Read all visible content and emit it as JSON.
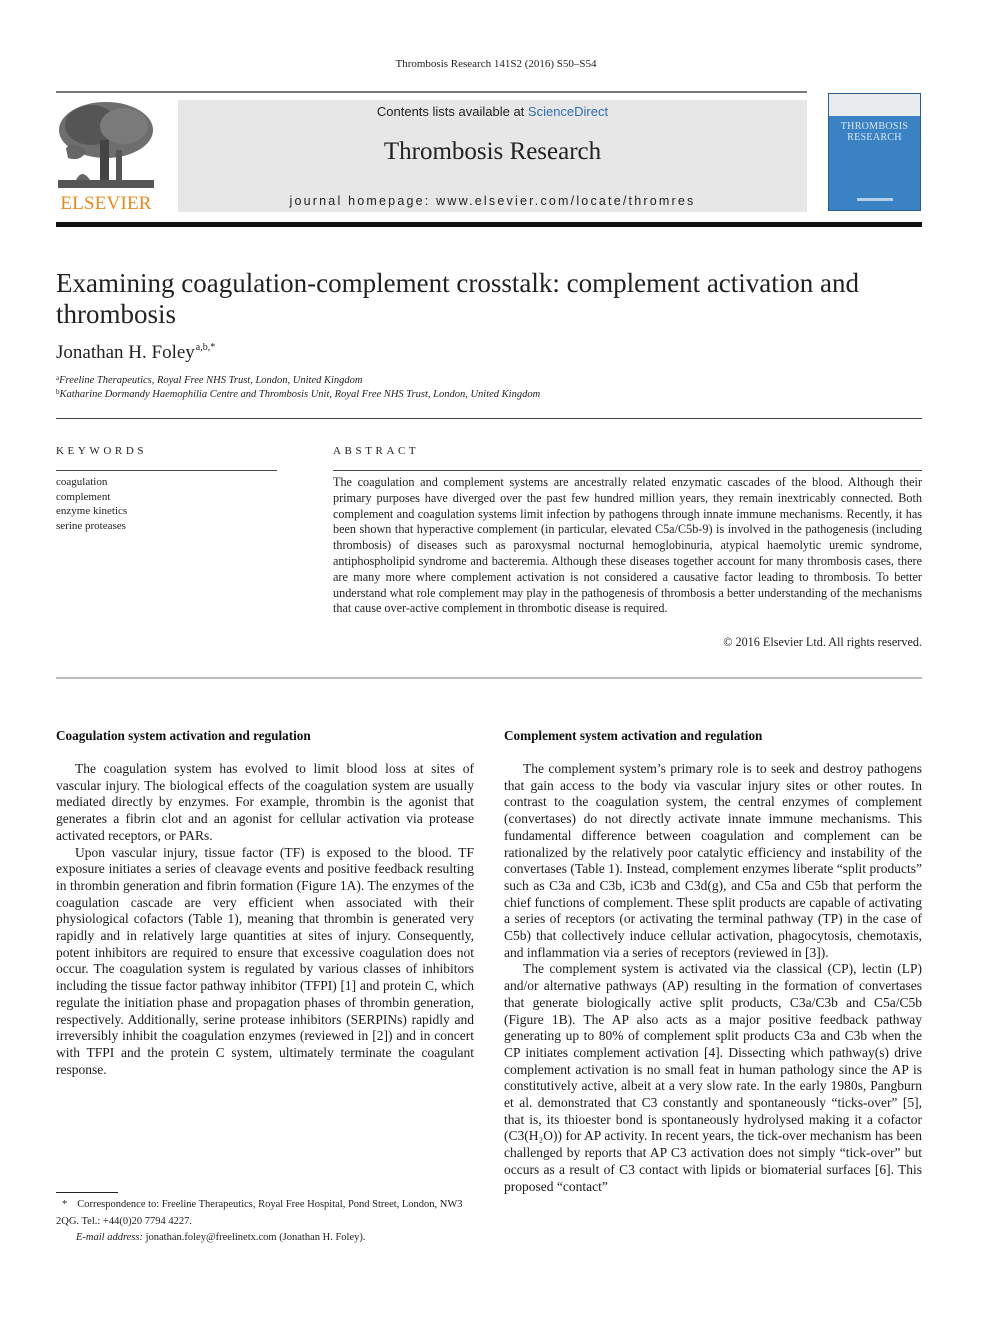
{
  "header": {
    "citation": "Thrombosis Research 141S2 (2016) S50–S54",
    "contents_prefix": "Contents lists available at ",
    "contents_link": "ScienceDirect",
    "journal_title": "Thrombosis Research",
    "homepage": "journal homepage: www.elsevier.com/locate/thromres",
    "publisher": "ELSEVIER",
    "cover_title": "THROMBOSIS RESEARCH",
    "colors": {
      "publisher_orange": "#e88a1a",
      "link_blue": "#2f6fb0",
      "cover_blue": "#3b82c4",
      "masthead_gray": "#e7e7e7"
    }
  },
  "article": {
    "title": "Examining coagulation-complement crosstalk: complement activation and thrombosis",
    "author": "Jonathan H. Foley",
    "author_marks": "a,b,*",
    "affiliations": [
      {
        "mark": "a",
        "text": "Freeline Therapeutics, Royal Free NHS Trust, London, United Kingdom"
      },
      {
        "mark": "b",
        "text": "Katharine Dormandy Haemophilia Centre and Thrombosis Unit, Royal Free NHS Trust, London, United Kingdom"
      }
    ]
  },
  "keywords": {
    "label": "KEYWORDS",
    "items": [
      "coagulation",
      "complement",
      "enzyme kinetics",
      "serine proteases"
    ]
  },
  "abstract": {
    "label": "ABSTRACT",
    "text": "The coagulation and complement systems are ancestrally related enzymatic cascades of the blood. Although their primary purposes have diverged over the past few hundred million years, they remain inextricably connected. Both complement and coagulation systems limit infection by pathogens through innate immune mechanisms. Recently, it has been shown that hyperactive complement (in particular, elevated C5a/C5b-9) is involved in the pathogenesis (including thrombosis) of diseases such as paroxysmal nocturnal hemoglobinuria, atypical haemolytic uremic syndrome, antiphospholipid syndrome and bacteremia. Although these diseases together account for many thrombosis cases, there are many more where complement activation is not considered a causative factor leading to thrombosis. To better understand what role complement may play in the pathogenesis of thrombosis a better understanding of the mechanisms that cause over-active complement in thrombotic disease is required.",
    "copyright": "© 2016 Elsevier Ltd. All rights reserved."
  },
  "sections": {
    "left": {
      "heading": "Coagulation system activation and regulation",
      "paragraphs": [
        "The coagulation system has evolved to limit blood loss at sites of vascular injury. The biological effects of the coagulation system are usually mediated directly by enzymes. For example, thrombin is the agonist that generates a fibrin clot and an agonist for cellular activation via protease activated receptors, or PARs.",
        "Upon vascular injury, tissue factor (TF) is exposed to the blood. TF exposure initiates a series of cleavage events and positive feedback resulting in thrombin generation and fibrin formation (Figure 1A). The enzymes of the coagulation cascade are very efficient when associated with their physiological cofactors (Table 1), meaning that thrombin is generated very rapidly and in relatively large quantities at sites of injury. Consequently, potent inhibitors are required to ensure that excessive coagulation does not occur. The coagulation system is regulated by various classes of inhibitors including the tissue factor pathway inhibitor (TFPI) [1] and protein C, which regulate the initiation phase and propagation phases of thrombin generation, respectively. Additionally, serine protease inhibitors (SERPINs) rapidly and irreversibly inhibit the coagulation enzymes (reviewed in [2]) and in concert with TFPI and the protein C system, ultimately terminate the coagulant response."
      ]
    },
    "right": {
      "heading": "Complement system activation and regulation",
      "paragraphs": [
        "The complement system’s primary role is to seek and destroy pathogens that gain access to the body via vascular injury sites or other routes. In contrast to the coagulation system, the central enzymes of complement (convertases) do not directly activate innate immune mechanisms. This fundamental difference between coagulation and complement can be rationalized by the relatively poor catalytic efficiency and instability of the convertases (Table 1). Instead, complement enzymes liberate “split products” such as C3a and C3b, iC3b and C3d(g), and C5a and C5b that perform the chief functions of complement. These split products are capable of activating a series of receptors (or activating the terminal pathway (TP) in the case of C5b) that collectively induce cellular activation, phagocytosis, chemotaxis, and inflammation via a series of receptors (reviewed in [3]).",
        "The complement system is activated via the classical (CP), lectin (LP) and/or alternative pathways (AP) resulting in the formation of convertases that generate biologically active split products, C3a/C3b and C5a/C5b (Figure 1B). The AP also acts as a major positive feedback pathway generating up to 80% of complement split products C3a and C3b when the CP initiates complement activation [4]. Dissecting which pathway(s) drive complement activation is no small feat in human pathology since the AP is constitutively active, albeit at a very slow rate. In the early 1980s, Pangburn et al. demonstrated that C3 constantly and spontaneously “ticks-over” [5], that is, its thioester bond is spontaneously hydrolysed making it a cofactor (C3(H₂O)) for AP activity. In recent years, the tick-over mechanism has been challenged by reports that AP C3 activation does not simply “tick-over” but occurs as a result of C3 contact with lipids or biomaterial surfaces [6]. This proposed “contact”"
      ]
    }
  },
  "footnote": {
    "star": "*",
    "correspondence": "Correspondence to: Freeline Therapeutics, Royal Free Hospital, Pond Street, London, NW3 2QG. Tel.: +44(0)20 7794 4227.",
    "email_label": "E-mail address:",
    "email": "jonathan.foley@freelinetx.com",
    "email_owner": "(Jonathan H. Foley)."
  }
}
